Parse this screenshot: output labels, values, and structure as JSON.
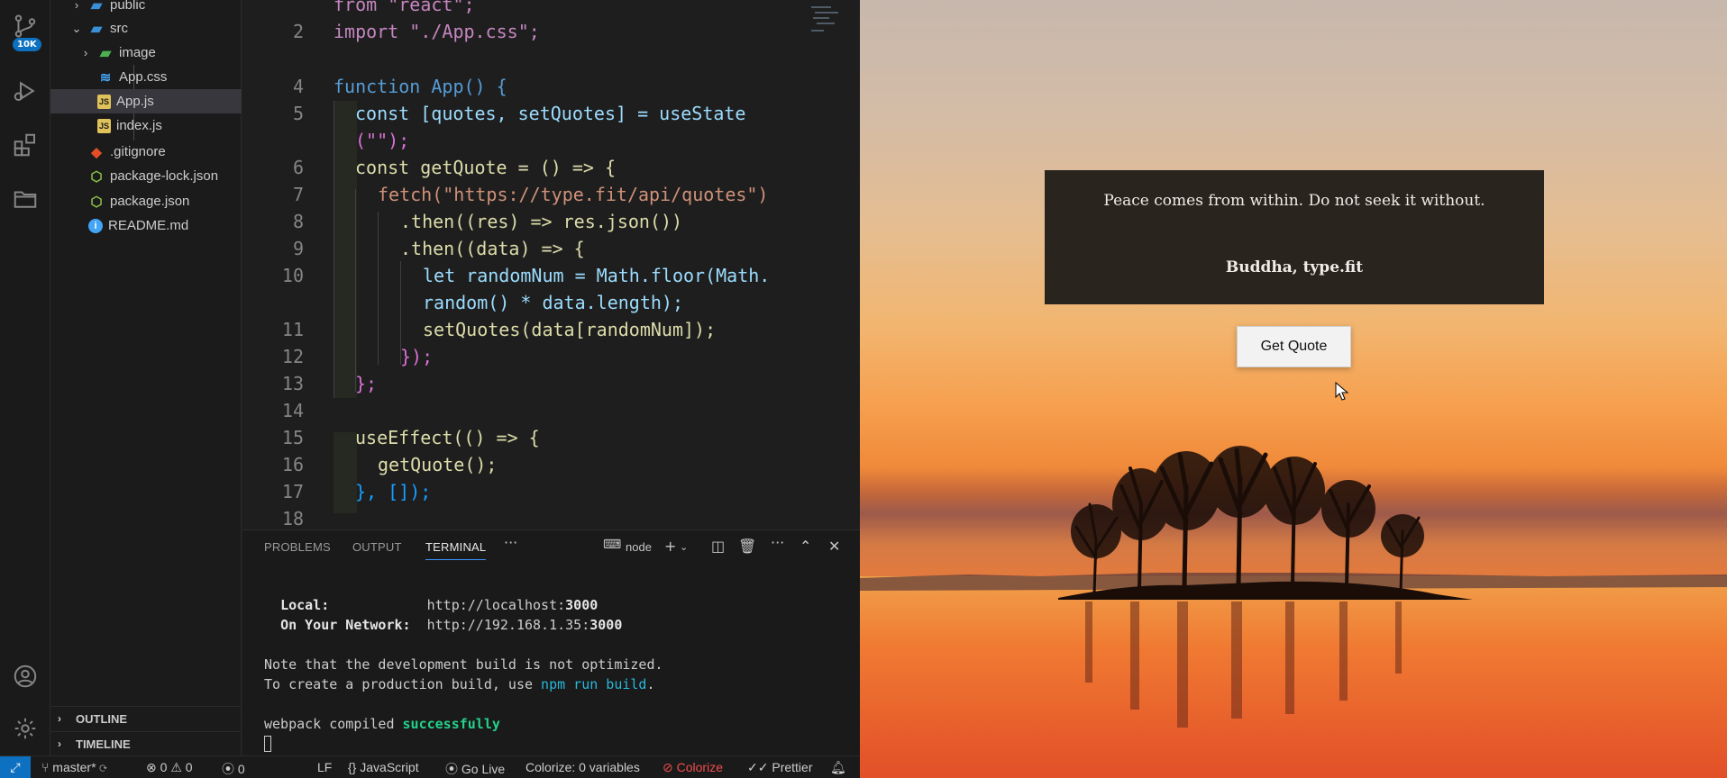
{
  "activity_bar": {
    "source_control_badge": "10K"
  },
  "explorer": {
    "items": [
      {
        "label": "public",
        "type": "folder",
        "expanded": false
      },
      {
        "label": "src",
        "type": "folder",
        "expanded": true
      },
      {
        "label": "image",
        "type": "folder",
        "expanded": false
      },
      {
        "label": "App.css",
        "type": "css"
      },
      {
        "label": "App.js",
        "type": "js",
        "selected": true
      },
      {
        "label": "index.js",
        "type": "js"
      },
      {
        "label": ".gitignore",
        "type": "git"
      },
      {
        "label": "package-lock.json",
        "type": "json"
      },
      {
        "label": "package.json",
        "type": "json"
      },
      {
        "label": "README.md",
        "type": "info"
      }
    ],
    "outline_label": "OUTLINE",
    "timeline_label": "TIMELINE"
  },
  "editor": {
    "line_numbers": [
      "2",
      "4",
      "5",
      "6",
      "7",
      "8",
      "9",
      "10",
      "11",
      "12",
      "13",
      "14",
      "15",
      "16",
      "17",
      "18"
    ],
    "lines": {
      "l1": "from \"react\";",
      "l2": "import \"./App.css\";",
      "l4": "function App() {",
      "l5a": "const [quotes, setQuotes] = useState",
      "l5b": "(\"\");",
      "l6": "const getQuote = () => {",
      "l7": "fetch(\"https://type.fit/api/quotes\")",
      "l8": ".then((res) => res.json())",
      "l9": ".then((data) => {",
      "l10a": "let randomNum = Math.floor(Math.",
      "l10b": "random() * data.length);",
      "l11": "setQuotes(data[randomNum]);",
      "l12": "});",
      "l13": "};",
      "l15": "useEffect(() => {",
      "l16": "getQuote();",
      "l17": "}, []);"
    }
  },
  "panel": {
    "tabs": [
      "PROBLEMS",
      "OUTPUT",
      "TERMINAL"
    ],
    "active_tab": "TERMINAL",
    "terminal_name": "node",
    "terminal": {
      "local_label": "Local:",
      "local_url_prefix": "http://localhost:",
      "local_port": "3000",
      "network_label": "On Your Network:",
      "network_url_prefix": "http://192.168.1.35:",
      "network_port": "3000",
      "note1": "Note that the development build is not optimized.",
      "note2_prefix": "To create a production build, use ",
      "note2_cmd": "npm run build",
      "note2_suffix": ".",
      "compiled_prefix": "webpack compiled ",
      "compiled_status": "successfully"
    }
  },
  "status_bar": {
    "branch": "master*",
    "errors": "0",
    "warnings": "0",
    "ports": "0",
    "eol": "LF",
    "language": "JavaScript",
    "go_live": "Go Live",
    "colorize_vars": "Colorize: 0 variables",
    "colorize": "Colorize",
    "prettier": "Prettier"
  },
  "preview": {
    "quote": "Peace comes from within. Do not seek it without.",
    "author": "Buddha, type.fit",
    "button_label": "Get Quote"
  },
  "colors": {
    "accent": "#0e70c0",
    "editor_bg": "#1e1e1e",
    "quote_box": "#2a241f"
  }
}
